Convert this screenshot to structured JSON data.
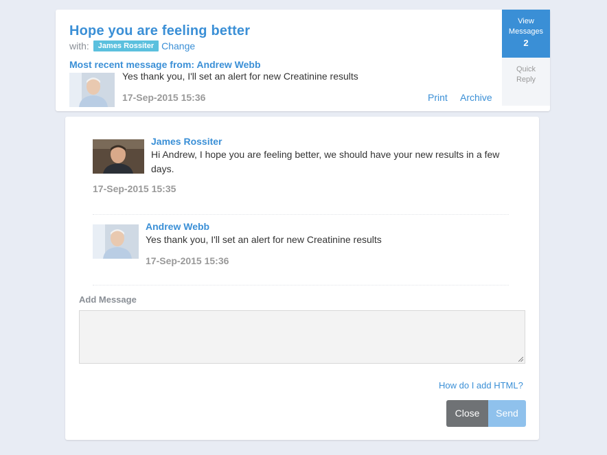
{
  "thread": {
    "subject": "Hope you are feeling better",
    "with_label": "with:",
    "participant_badge": "James Rossiter",
    "change_link": "Change",
    "recent_label": "Most recent message from: Andrew Webb",
    "recent_text": "Yes thank you, I'll set an alert for new Creatinine results",
    "recent_date": "17-Sep-2015 15:36",
    "print_link": "Print",
    "archive_link": "Archive"
  },
  "side": {
    "view_line1": "View",
    "view_line2": "Messages",
    "view_count": "2",
    "quick_line1": "Quick",
    "quick_line2": "Reply"
  },
  "messages": [
    {
      "sender": "James Rossiter",
      "text": "Hi Andrew, I hope you are feeling better, we should have your new results in a few days.",
      "date": "17-Sep-2015 15:35"
    },
    {
      "sender": "Andrew Webb",
      "text": "Yes thank you, I'll set an alert for new Creatinine results",
      "date": "17-Sep-2015 15:36"
    }
  ],
  "compose": {
    "label": "Add Message",
    "value": "",
    "help_link": "How do I add HTML?",
    "close_button": "Close",
    "send_button": "Send"
  },
  "colors": {
    "accent": "#3a8fd6",
    "badge": "#5bc0de",
    "close_button": "#6f7275",
    "send_button": "#8fc1ec",
    "background": "#e8ecf4"
  }
}
